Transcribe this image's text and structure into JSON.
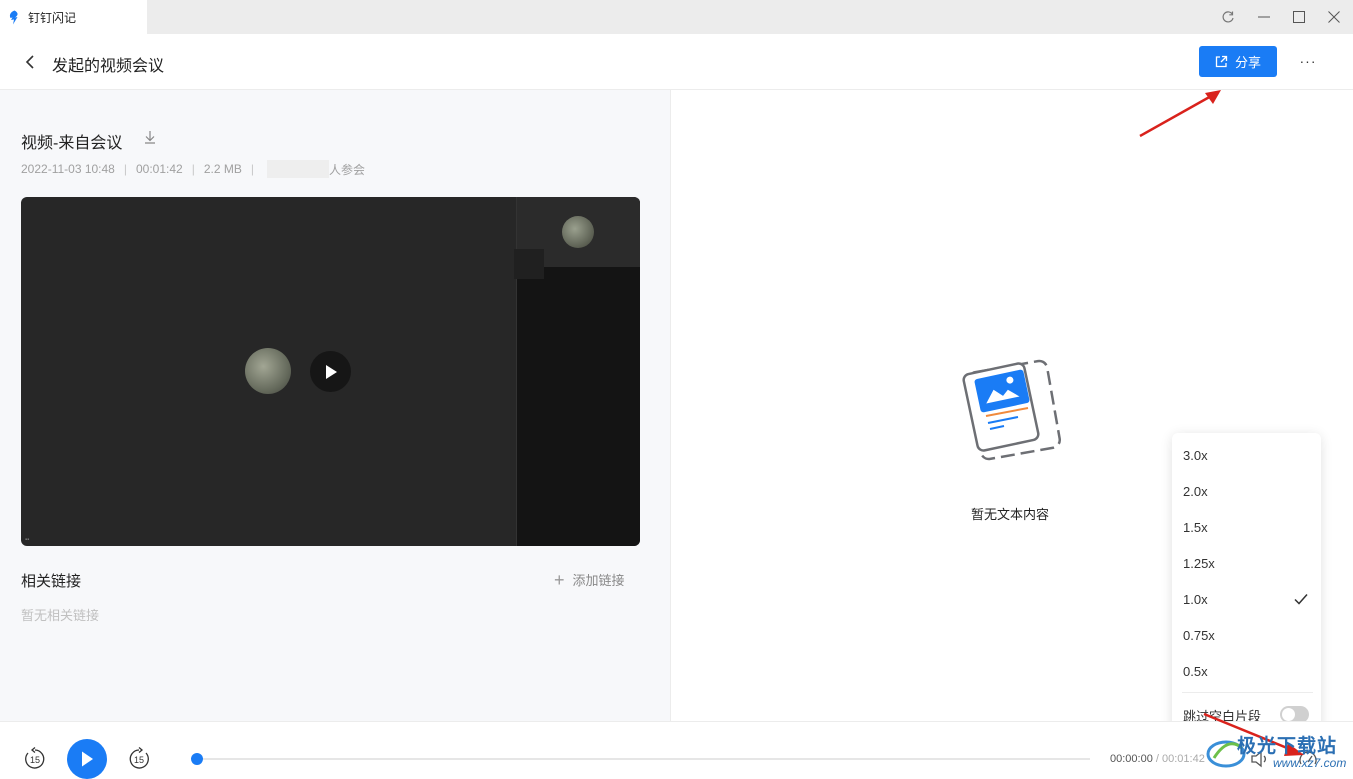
{
  "app": {
    "title": "钉钉闪记",
    "brand_color": "#1a7cf5"
  },
  "window_controls": [
    "sync-icon",
    "minimize-icon",
    "maximize-icon",
    "close-icon"
  ],
  "header": {
    "title": "发起的视频会议",
    "share_label": "分享",
    "more_label": "···"
  },
  "recording": {
    "title": "视频-来自会议",
    "date": "2022-11-03 10:48",
    "duration": "00:01:42",
    "size": "2.2 MB",
    "participants_suffix": "人参会"
  },
  "related_links": {
    "title": "相关链接",
    "add_label": "添加链接",
    "empty_text": "暂无相关链接"
  },
  "transcript": {
    "empty_text": "暂无文本内容"
  },
  "speed_menu": {
    "options": [
      "3.0x",
      "2.0x",
      "1.5x",
      "1.25x",
      "1.0x",
      "0.75x",
      "0.5x"
    ],
    "selected": "1.0x",
    "skip_blank_label": "跳过空白片段",
    "skip_blank_enabled": false
  },
  "player": {
    "rewind_label": "15",
    "forward_label": "15",
    "current_time": "00:00:00",
    "total_time": "/ 00:01:42",
    "progress_fraction": 0
  },
  "watermark": {
    "text": "极光下载站",
    "url": "www.xz7.com"
  }
}
